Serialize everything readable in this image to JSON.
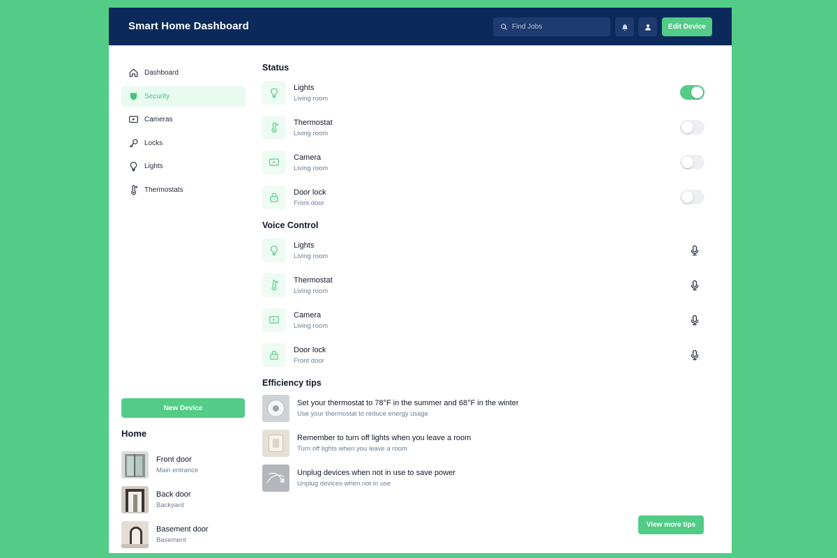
{
  "header": {
    "title": "Smart Home  Dashboard",
    "search_placeholder": "Find Jobs",
    "edit_label": "Edit Device",
    "bell_icon": "bell-icon",
    "user_icon": "user-icon"
  },
  "sidebar": {
    "items": [
      {
        "label": "Dashboard",
        "icon": "home-icon",
        "active": false
      },
      {
        "label": "Security",
        "icon": "shield-icon",
        "active": true
      },
      {
        "label": "Cameras",
        "icon": "video-icon",
        "active": false
      },
      {
        "label": "Locks",
        "icon": "key-icon",
        "active": false
      },
      {
        "label": "Lights",
        "icon": "bulb-icon",
        "active": false
      },
      {
        "label": "Thermostats",
        "icon": "thermometer-icon",
        "active": false
      }
    ],
    "new_device_label": "New Device",
    "home_title": "Home",
    "home_items": [
      {
        "name": "Front door",
        "sub": "Main entrance"
      },
      {
        "name": "Back door",
        "sub": "Backyard"
      },
      {
        "name": "Basement door",
        "sub": "Basement"
      }
    ]
  },
  "status": {
    "title": "Status",
    "items": [
      {
        "name": "Lights",
        "sub": "Living room",
        "icon": "bulb-icon",
        "on": true
      },
      {
        "name": "Thermostat",
        "sub": "Living room",
        "icon": "thermometer-icon",
        "on": false
      },
      {
        "name": "Camera",
        "sub": "Living room",
        "icon": "video-icon",
        "on": false
      },
      {
        "name": "Door lock",
        "sub": "Front door",
        "icon": "lock-icon",
        "on": false
      }
    ]
  },
  "voice": {
    "title": "Voice Control",
    "items": [
      {
        "name": "Lights",
        "sub": "Living room",
        "icon": "bulb-icon"
      },
      {
        "name": "Thermostat",
        "sub": "Living room",
        "icon": "thermometer-icon"
      },
      {
        "name": "Camera",
        "sub": "Living room",
        "icon": "video-icon"
      },
      {
        "name": "Door lock",
        "sub": "Front door",
        "icon": "lock-icon"
      }
    ]
  },
  "tips": {
    "title": "Efficiency tips",
    "items": [
      {
        "name": "Set your thermostat to 78°F in the summer and 68°F in the winter",
        "sub": "Use your thermostat to reduce energy usage"
      },
      {
        "name": "Remember to turn off lights when you leave a room",
        "sub": "Turn off lights when you leave a room"
      },
      {
        "name": "Unplug devices when not in use to save power",
        "sub": "Unplug devices when not in use"
      }
    ],
    "view_more_label": "View more tips"
  },
  "colors": {
    "background": "#52cc87",
    "header": "#0b2a5b",
    "accent": "#52cc87",
    "active_bg": "#e8fbf0"
  }
}
